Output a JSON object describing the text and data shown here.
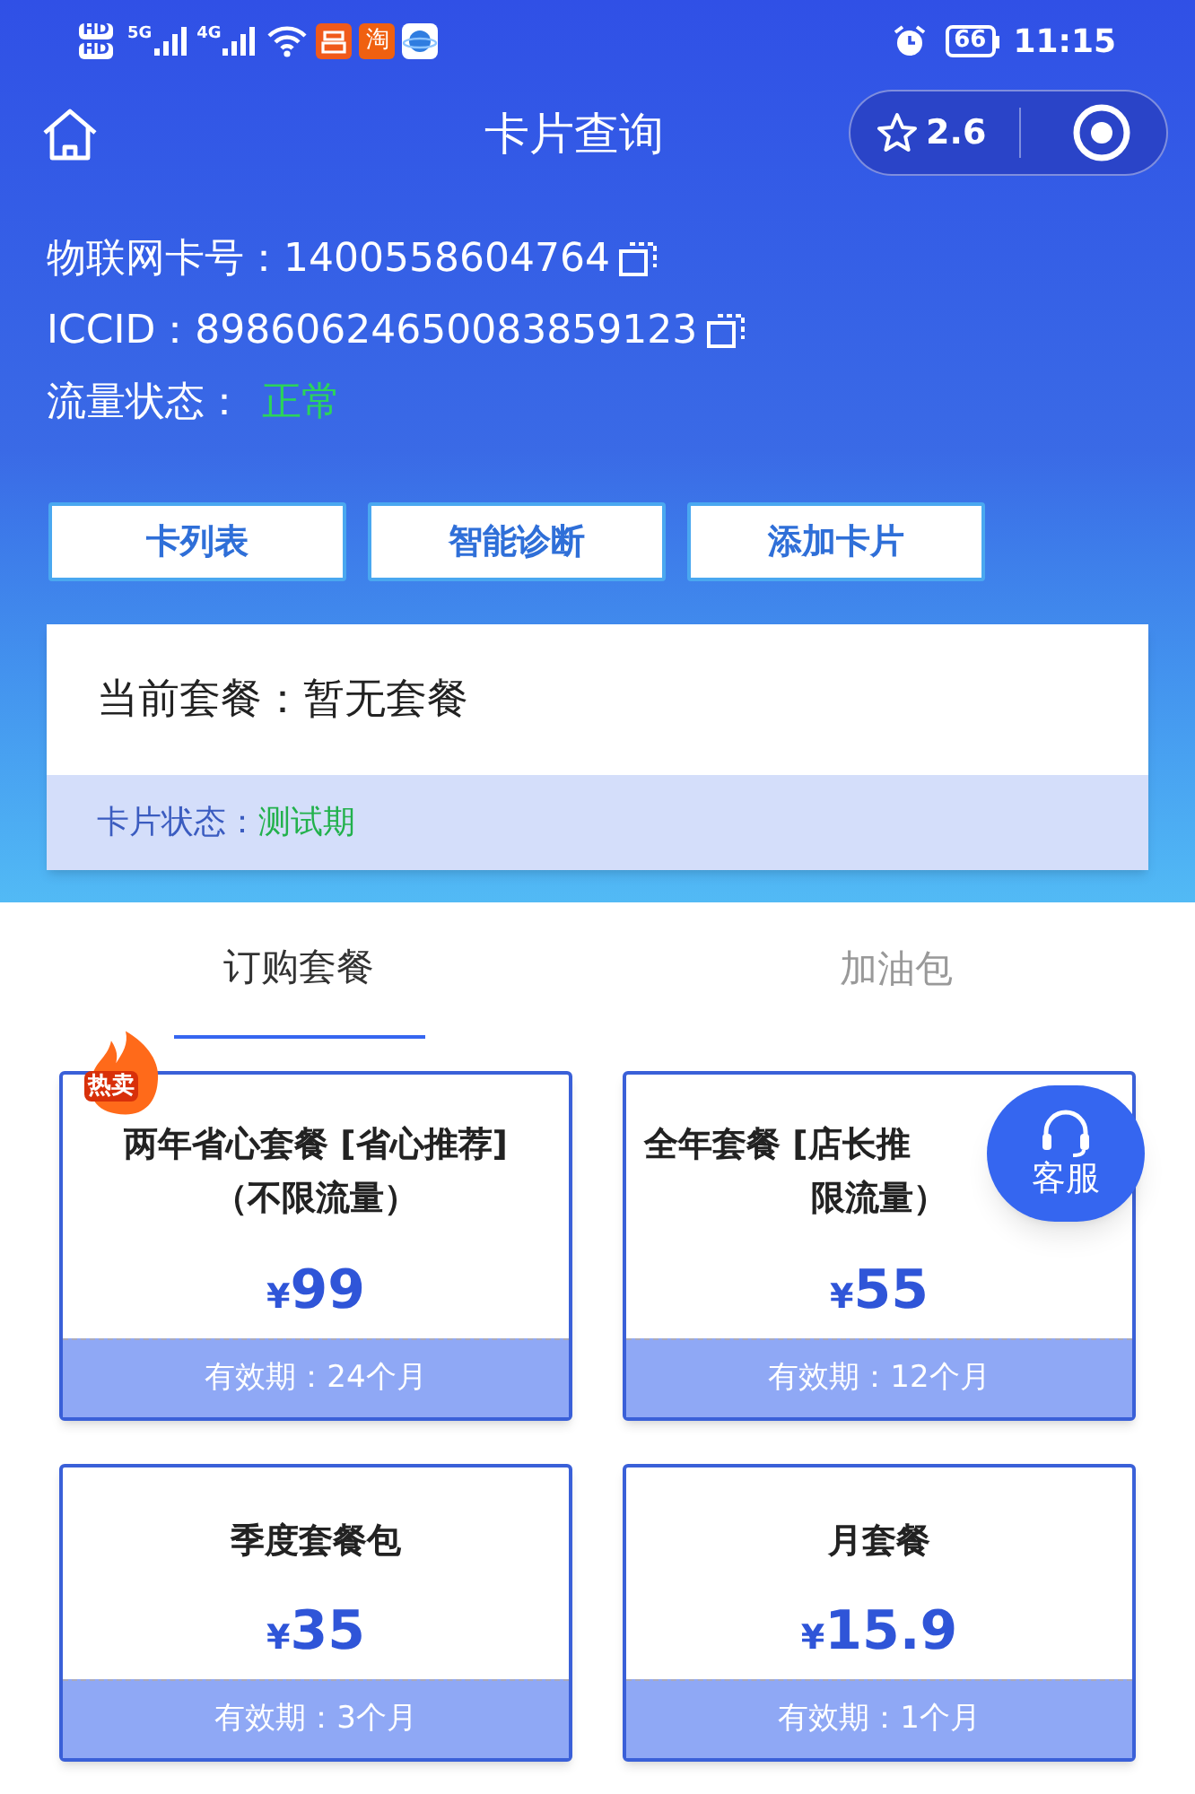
{
  "status_bar": {
    "sim_labels": [
      "HD",
      "HD"
    ],
    "network": [
      "5G",
      "4G"
    ],
    "app_badge": "淘",
    "battery": "66",
    "time": "11:15"
  },
  "nav": {
    "title": "卡片查询",
    "rating": "2.6"
  },
  "info": [
    {
      "label": "物联网卡号：",
      "value": "1400558604764",
      "kind": "copy"
    },
    {
      "label": "ICCID：",
      "value": "89860624650083859123",
      "kind": "copy"
    },
    {
      "label": "流量状态：",
      "value": "正常",
      "kind": "status"
    }
  ],
  "actions": [
    "卡列表",
    "智能诊断",
    "添加卡片"
  ],
  "current": {
    "label": "当前套餐：",
    "value": "暂无套餐",
    "status_label": "卡片状态：",
    "status_value": "测试期"
  },
  "tabs": [
    {
      "label": "订购套餐",
      "selected": true
    },
    {
      "label": "加油包",
      "selected": false
    }
  ],
  "plans": [
    {
      "title_lines": [
        "两年省心套餐 [省心推荐]",
        "（不限流量）"
      ],
      "currency": "¥",
      "price": "99",
      "validity": "有效期：24个月",
      "hot": true,
      "hot_label": "热卖"
    },
    {
      "title_lines": [
        "全年套餐 [店长推",
        "限流量）"
      ],
      "currency": "¥",
      "price": "55",
      "validity": "有效期：12个月",
      "hot": false
    },
    {
      "title_lines": [
        "季度套餐包"
      ],
      "currency": "¥",
      "price": "35",
      "validity": "有效期：3个月",
      "hot": false
    },
    {
      "title_lines": [
        "月套餐"
      ],
      "currency": "¥",
      "price": "15.9",
      "validity": "有效期：1个月",
      "hot": false
    }
  ],
  "service_button": "客服"
}
